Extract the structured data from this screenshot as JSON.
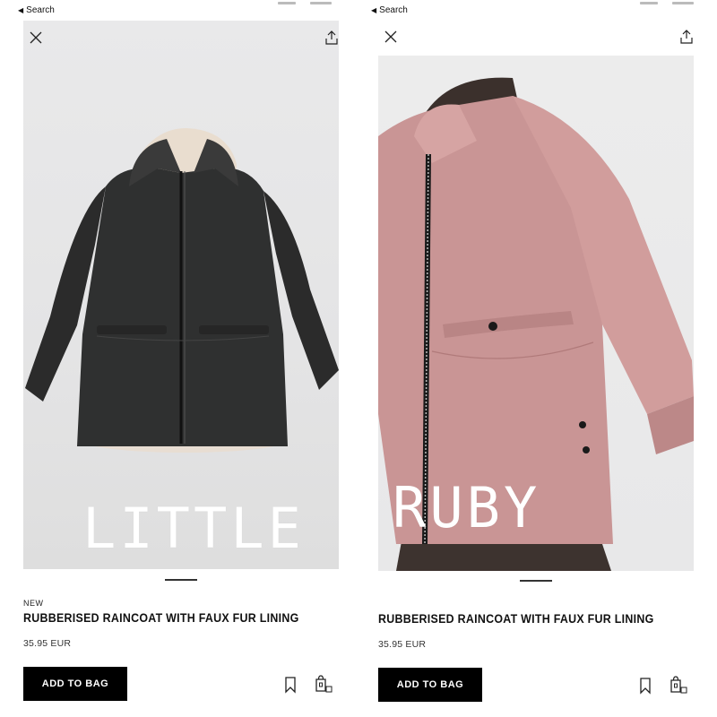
{
  "colors": {
    "accent": "#000000",
    "button_text": "#ffffff",
    "coat_left": "#2f2f2f",
    "coat_right": "#c99595"
  },
  "screens": [
    {
      "status": {
        "back_label": "Search"
      },
      "watermark": "LITTLE",
      "product": {
        "tag": "NEW",
        "title": "RUBBERISED RAINCOAT WITH FAUX FUR LINING",
        "price": "35.95 EUR",
        "add_to_bag": "ADD TO BAG"
      },
      "icons": [
        "close-icon",
        "share-icon",
        "bookmark-icon",
        "bag-size-icon"
      ]
    },
    {
      "status": {
        "back_label": "Search"
      },
      "watermark": "RUBY",
      "product": {
        "title": "RUBBERISED RAINCOAT WITH FAUX FUR LINING",
        "price": "35.95 EUR",
        "add_to_bag": "ADD TO BAG"
      },
      "icons": [
        "close-icon",
        "share-icon",
        "bookmark-icon",
        "bag-size-icon"
      ]
    }
  ]
}
